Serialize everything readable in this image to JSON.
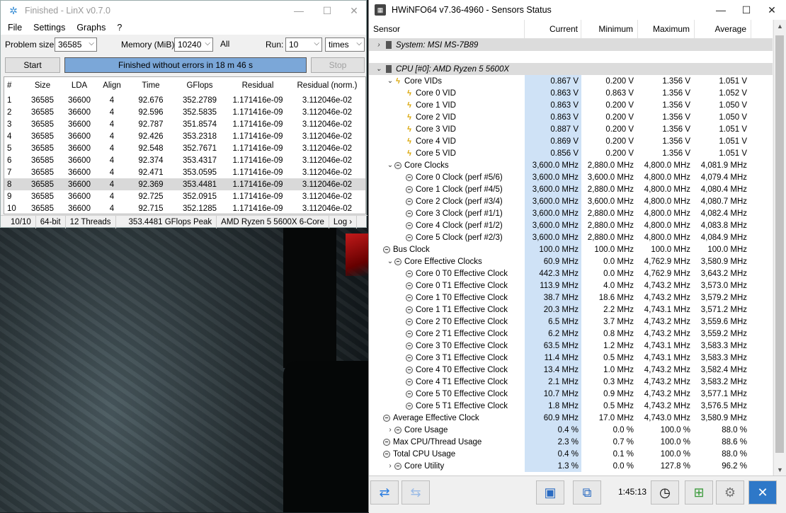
{
  "linx": {
    "title": "Finished - LinX v0.7.0",
    "menu": [
      "File",
      "Settings",
      "Graphs",
      "?"
    ],
    "params": {
      "problem_size_label": "Problem size:",
      "problem_size": "36585",
      "memory_label": "Memory (MiB):",
      "memory": "10240",
      "all_label": "All",
      "run_label": "Run:",
      "run": "10",
      "run_unit": "times"
    },
    "start_label": "Start",
    "stop_label": "Stop",
    "progress_text": "Finished without errors in 18 m 46 s",
    "table": {
      "headers": [
        "#",
        "Size",
        "LDA",
        "Align",
        "Time",
        "GFlops",
        "Residual",
        "Residual (norm.)"
      ],
      "rows": [
        [
          "1",
          "36585",
          "36600",
          "4",
          "92.676",
          "352.2789",
          "1.171416e-09",
          "3.112046e-02"
        ],
        [
          "2",
          "36585",
          "36600",
          "4",
          "92.596",
          "352.5835",
          "1.171416e-09",
          "3.112046e-02"
        ],
        [
          "3",
          "36585",
          "36600",
          "4",
          "92.787",
          "351.8574",
          "1.171416e-09",
          "3.112046e-02"
        ],
        [
          "4",
          "36585",
          "36600",
          "4",
          "92.426",
          "353.2318",
          "1.171416e-09",
          "3.112046e-02"
        ],
        [
          "5",
          "36585",
          "36600",
          "4",
          "92.548",
          "352.7671",
          "1.171416e-09",
          "3.112046e-02"
        ],
        [
          "6",
          "36585",
          "36600",
          "4",
          "92.374",
          "353.4317",
          "1.171416e-09",
          "3.112046e-02"
        ],
        [
          "7",
          "36585",
          "36600",
          "4",
          "92.471",
          "353.0595",
          "1.171416e-09",
          "3.112046e-02"
        ],
        [
          "8",
          "36585",
          "36600",
          "4",
          "92.369",
          "353.4481",
          "1.171416e-09",
          "3.112046e-02"
        ],
        [
          "9",
          "36585",
          "36600",
          "4",
          "92.725",
          "352.0915",
          "1.171416e-09",
          "3.112046e-02"
        ],
        [
          "10",
          "36585",
          "36600",
          "4",
          "92.715",
          "352.1285",
          "1.171416e-09",
          "3.112046e-02"
        ]
      ],
      "selected_row": 7
    },
    "status": [
      "10/10",
      "64-bit",
      "12 Threads",
      "353.4481 GFlops Peak",
      "AMD Ryzen 5 5600X 6-Core",
      "Log ›"
    ]
  },
  "hwinfo": {
    "title": "HWiNFO64 v7.36-4960 - Sensors Status",
    "headers": [
      "Sensor",
      "Current",
      "Minimum",
      "Maximum",
      "Average"
    ],
    "rows": [
      {
        "kind": "group",
        "indent": 0,
        "toggle": ">",
        "icon": "chip",
        "name": "System: MSI MS-7B89",
        "v": [
          "",
          "",
          "",
          ""
        ]
      },
      {
        "kind": "blank",
        "indent": 0,
        "toggle": "",
        "icon": "",
        "name": "",
        "v": [
          "",
          "",
          "",
          ""
        ]
      },
      {
        "kind": "group",
        "indent": 0,
        "toggle": "v",
        "icon": "chip",
        "name": "CPU [#0]: AMD Ryzen 5 5600X",
        "v": [
          "",
          "",
          "",
          ""
        ]
      },
      {
        "kind": "row",
        "indent": 1,
        "toggle": "v",
        "icon": "bolt",
        "name": "Core VIDs",
        "v": [
          "0.867 V",
          "0.200 V",
          "1.356 V",
          "1.051 V"
        ]
      },
      {
        "kind": "row",
        "indent": 2,
        "toggle": "",
        "icon": "bolt",
        "name": "Core 0 VID",
        "v": [
          "0.863 V",
          "0.863 V",
          "1.356 V",
          "1.052 V"
        ]
      },
      {
        "kind": "row",
        "indent": 2,
        "toggle": "",
        "icon": "bolt",
        "name": "Core 1 VID",
        "v": [
          "0.863 V",
          "0.200 V",
          "1.356 V",
          "1.050 V"
        ]
      },
      {
        "kind": "row",
        "indent": 2,
        "toggle": "",
        "icon": "bolt",
        "name": "Core 2 VID",
        "v": [
          "0.863 V",
          "0.200 V",
          "1.356 V",
          "1.050 V"
        ]
      },
      {
        "kind": "row",
        "indent": 2,
        "toggle": "",
        "icon": "bolt",
        "name": "Core 3 VID",
        "v": [
          "0.887 V",
          "0.200 V",
          "1.356 V",
          "1.051 V"
        ]
      },
      {
        "kind": "row",
        "indent": 2,
        "toggle": "",
        "icon": "bolt",
        "name": "Core 4 VID",
        "v": [
          "0.869 V",
          "0.200 V",
          "1.356 V",
          "1.051 V"
        ]
      },
      {
        "kind": "row",
        "indent": 2,
        "toggle": "",
        "icon": "bolt",
        "name": "Core 5 VID",
        "v": [
          "0.856 V",
          "0.200 V",
          "1.356 V",
          "1.051 V"
        ]
      },
      {
        "kind": "row",
        "indent": 1,
        "toggle": "v",
        "icon": "clock",
        "name": "Core Clocks",
        "v": [
          "3,600.0 MHz",
          "2,880.0 MHz",
          "4,800.0 MHz",
          "4,081.9 MHz"
        ]
      },
      {
        "kind": "row",
        "indent": 2,
        "toggle": "",
        "icon": "",
        "name": "Core 0 Clock (perf #5/6)",
        "v": [
          "3,600.0 MHz",
          "3,600.0 MHz",
          "4,800.0 MHz",
          "4,079.4 MHz"
        ]
      },
      {
        "kind": "row",
        "indent": 2,
        "toggle": "",
        "icon": "",
        "name": "Core 1 Clock (perf #4/5)",
        "v": [
          "3,600.0 MHz",
          "2,880.0 MHz",
          "4,800.0 MHz",
          "4,080.4 MHz"
        ]
      },
      {
        "kind": "row",
        "indent": 2,
        "toggle": "",
        "icon": "",
        "name": "Core 2 Clock (perf #3/4)",
        "v": [
          "3,600.0 MHz",
          "3,600.0 MHz",
          "4,800.0 MHz",
          "4,080.7 MHz"
        ]
      },
      {
        "kind": "row",
        "indent": 2,
        "toggle": "",
        "icon": "",
        "name": "Core 3 Clock (perf #1/1)",
        "v": [
          "3,600.0 MHz",
          "2,880.0 MHz",
          "4,800.0 MHz",
          "4,082.4 MHz"
        ]
      },
      {
        "kind": "row",
        "indent": 2,
        "toggle": "",
        "icon": "",
        "name": "Core 4 Clock (perf #1/2)",
        "v": [
          "3,600.0 MHz",
          "2,880.0 MHz",
          "4,800.0 MHz",
          "4,083.8 MHz"
        ]
      },
      {
        "kind": "row",
        "indent": 2,
        "toggle": "",
        "icon": "",
        "name": "Core 5 Clock (perf #2/3)",
        "v": [
          "3,600.0 MHz",
          "2,880.0 MHz",
          "4,800.0 MHz",
          "4,084.9 MHz"
        ]
      },
      {
        "kind": "row",
        "indent": 0,
        "toggle": "",
        "icon": "clock",
        "name": "Bus Clock",
        "v": [
          "100.0 MHz",
          "100.0 MHz",
          "100.0 MHz",
          "100.0 MHz"
        ]
      },
      {
        "kind": "row",
        "indent": 1,
        "toggle": "v",
        "icon": "clock",
        "name": "Core Effective Clocks",
        "v": [
          "60.9 MHz",
          "0.0 MHz",
          "4,762.9 MHz",
          "3,580.9 MHz"
        ]
      },
      {
        "kind": "row",
        "indent": 2,
        "toggle": "",
        "icon": "",
        "name": "Core 0 T0 Effective Clock",
        "v": [
          "442.3 MHz",
          "0.0 MHz",
          "4,762.9 MHz",
          "3,643.2 MHz"
        ]
      },
      {
        "kind": "row",
        "indent": 2,
        "toggle": "",
        "icon": "",
        "name": "Core 0 T1 Effective Clock",
        "v": [
          "113.9 MHz",
          "4.0 MHz",
          "4,743.2 MHz",
          "3,573.0 MHz"
        ]
      },
      {
        "kind": "row",
        "indent": 2,
        "toggle": "",
        "icon": "",
        "name": "Core 1 T0 Effective Clock",
        "v": [
          "38.7 MHz",
          "18.6 MHz",
          "4,743.2 MHz",
          "3,579.2 MHz"
        ]
      },
      {
        "kind": "row",
        "indent": 2,
        "toggle": "",
        "icon": "",
        "name": "Core 1 T1 Effective Clock",
        "v": [
          "20.3 MHz",
          "2.2 MHz",
          "4,743.1 MHz",
          "3,571.2 MHz"
        ]
      },
      {
        "kind": "row",
        "indent": 2,
        "toggle": "",
        "icon": "",
        "name": "Core 2 T0 Effective Clock",
        "v": [
          "6.5 MHz",
          "3.7 MHz",
          "4,743.2 MHz",
          "3,559.6 MHz"
        ]
      },
      {
        "kind": "row",
        "indent": 2,
        "toggle": "",
        "icon": "",
        "name": "Core 2 T1 Effective Clock",
        "v": [
          "6.2 MHz",
          "0.8 MHz",
          "4,743.2 MHz",
          "3,559.2 MHz"
        ]
      },
      {
        "kind": "row",
        "indent": 2,
        "toggle": "",
        "icon": "",
        "name": "Core 3 T0 Effective Clock",
        "v": [
          "63.5 MHz",
          "1.2 MHz",
          "4,743.1 MHz",
          "3,583.3 MHz"
        ]
      },
      {
        "kind": "row",
        "indent": 2,
        "toggle": "",
        "icon": "",
        "name": "Core 3 T1 Effective Clock",
        "v": [
          "11.4 MHz",
          "0.5 MHz",
          "4,743.1 MHz",
          "3,583.3 MHz"
        ]
      },
      {
        "kind": "row",
        "indent": 2,
        "toggle": "",
        "icon": "",
        "name": "Core 4 T0 Effective Clock",
        "v": [
          "13.4 MHz",
          "1.0 MHz",
          "4,743.2 MHz",
          "3,582.4 MHz"
        ]
      },
      {
        "kind": "row",
        "indent": 2,
        "toggle": "",
        "icon": "",
        "name": "Core 4 T1 Effective Clock",
        "v": [
          "2.1 MHz",
          "0.3 MHz",
          "4,743.2 MHz",
          "3,583.2 MHz"
        ]
      },
      {
        "kind": "row",
        "indent": 2,
        "toggle": "",
        "icon": "",
        "name": "Core 5 T0 Effective Clock",
        "v": [
          "10.7 MHz",
          "0.9 MHz",
          "4,743.2 MHz",
          "3,577.1 MHz"
        ]
      },
      {
        "kind": "row",
        "indent": 2,
        "toggle": "",
        "icon": "",
        "name": "Core 5 T1 Effective Clock",
        "v": [
          "1.8 MHz",
          "0.5 MHz",
          "4,743.2 MHz",
          "3,576.5 MHz"
        ]
      },
      {
        "kind": "row",
        "indent": 0,
        "toggle": "",
        "icon": "clock",
        "name": "Average Effective Clock",
        "v": [
          "60.9 MHz",
          "17.0 MHz",
          "4,743.0 MHz",
          "3,580.9 MHz"
        ]
      },
      {
        "kind": "row",
        "indent": 1,
        "toggle": ">",
        "icon": "clock",
        "name": "Core Usage",
        "v": [
          "0.4 %",
          "0.0 %",
          "100.0 %",
          "88.0 %"
        ]
      },
      {
        "kind": "row",
        "indent": 0,
        "toggle": "",
        "icon": "clock",
        "name": "Max CPU/Thread Usage",
        "v": [
          "2.3 %",
          "0.7 %",
          "100.0 %",
          "88.6 %"
        ]
      },
      {
        "kind": "row",
        "indent": 0,
        "toggle": "",
        "icon": "clock",
        "name": "Total CPU Usage",
        "v": [
          "0.4 %",
          "0.1 %",
          "100.0 %",
          "88.0 %"
        ]
      },
      {
        "kind": "row",
        "indent": 1,
        "toggle": ">",
        "icon": "clock",
        "name": "Core Utility",
        "v": [
          "1.3 %",
          "0.0 %",
          "127.8 %",
          "96.2 %"
        ]
      }
    ],
    "timer": "1:45:13"
  }
}
